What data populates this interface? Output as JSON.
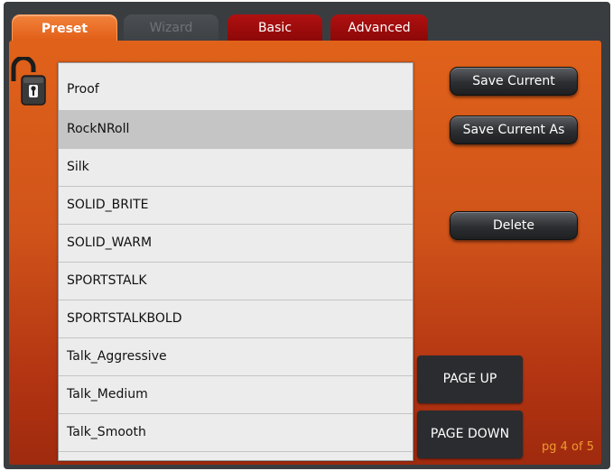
{
  "tabs": {
    "preset": "Preset",
    "wizard": "Wizard",
    "basic": "Basic",
    "advanced": "Advanced"
  },
  "presets": [
    "Proof",
    "RockNRoll",
    "Silk",
    "SOLID_BRITE",
    "SOLID_WARM",
    "SPORTSTALK",
    "SPORTSTALKBOLD",
    "Talk_Aggressive",
    "Talk_Medium",
    "Talk_Smooth"
  ],
  "selected_preset": "RockNRoll",
  "buttons": {
    "save_current": "Save Current",
    "save_current_as": "Save Current As",
    "delete": "Delete",
    "page_up": "PAGE UP",
    "page_down": "PAGE DOWN"
  },
  "pagination": {
    "label": "pg 4 of 5",
    "current": 4,
    "total": 5
  },
  "icons": {
    "lock": "unlocked-padlock-icon"
  },
  "colors": {
    "active_tab": "#e96f22",
    "red_tab": "#a00d0d",
    "panel_top": "#e0621a",
    "panel_bottom": "#9f2a0e",
    "page_indicator": "#f09a30"
  }
}
